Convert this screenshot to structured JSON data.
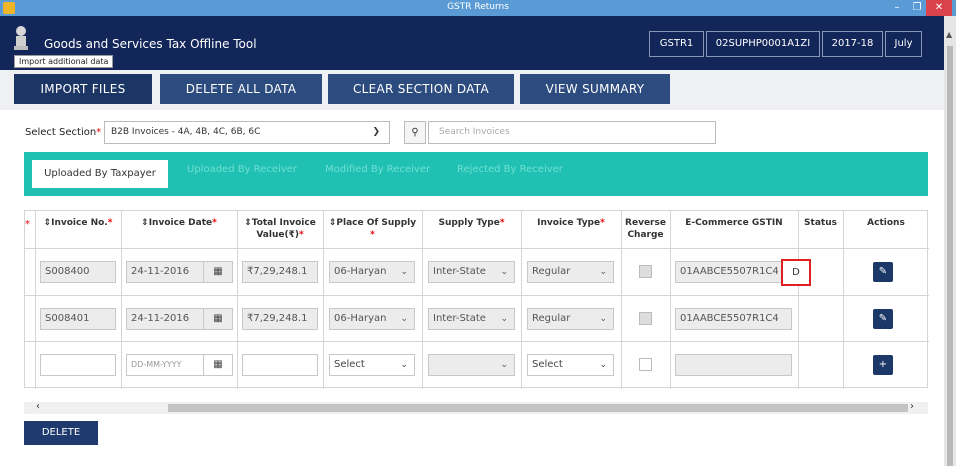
{
  "window": {
    "title": "GSTR Returns",
    "min": "–",
    "max": "❐",
    "close": "✕"
  },
  "header": {
    "app_title": "Goods and Services Tax Offline Tool",
    "tooltip": "Import additional data",
    "return_type": "GSTR1",
    "gstin": "02SUPHP0001A1ZI",
    "fin_year": "2017-18",
    "month": "July"
  },
  "toolbar": {
    "import": "IMPORT FILES",
    "delete_all": "DELETE ALL DATA",
    "clear_section": "CLEAR SECTION DATA",
    "view_summary": "VIEW SUMMARY"
  },
  "section": {
    "label": "Select Section",
    "value": "B2B Invoices - 4A, 4B, 4C, 6B, 6C",
    "search_placeholder": "Search Invoices"
  },
  "tabs": [
    "Uploaded By Taxpayer",
    "Uploaded By Receiver",
    "Modified By Receiver",
    "Rejected By Receiver"
  ],
  "table": {
    "columns": {
      "invoice_no": "⇕Invoice No.",
      "invoice_date": "⇕Invoice Date",
      "total_value_1": "⇕Total Invoice",
      "total_value_2": "Value(₹)",
      "place_of_supply": "⇕Place Of Supply",
      "supply_type": "Supply Type",
      "invoice_type": "Invoice Type",
      "reverse_1": "Reverse",
      "reverse_2": "Charge",
      "ecom_gstin": "E-Commerce GSTIN",
      "status": "Status",
      "actions": "Actions"
    },
    "rows": [
      {
        "invoice_no": "S008400",
        "invoice_date": "24-11-2016",
        "total_value": "₹7,29,248.1",
        "place_of_supply": "06-Haryan",
        "supply_type": "Inter-State",
        "invoice_type": "Regular",
        "ecom_gstin": "01AABCE5507R1C4",
        "status": "D"
      },
      {
        "invoice_no": "S008401",
        "invoice_date": "24-11-2016",
        "total_value": "₹7,29,248.1",
        "place_of_supply": "06-Haryan",
        "supply_type": "Inter-State",
        "invoice_type": "Regular",
        "ecom_gstin": "01AABCE5507R1C4",
        "status": ""
      }
    ],
    "new_row": {
      "date_placeholder": "DD-MM-YYYY",
      "place_of_supply": "Select",
      "invoice_type": "Select"
    }
  },
  "footer": {
    "delete": "DELETE"
  },
  "icons": {
    "calendar": "calendar-icon",
    "edit": "pencil-icon",
    "add": "plus-icon",
    "search": "search-icon"
  },
  "colors": {
    "header_bg": "#13265a",
    "tab_band": "#20c1b3",
    "button": "#2c4b7f",
    "status_border": "#e02020"
  }
}
